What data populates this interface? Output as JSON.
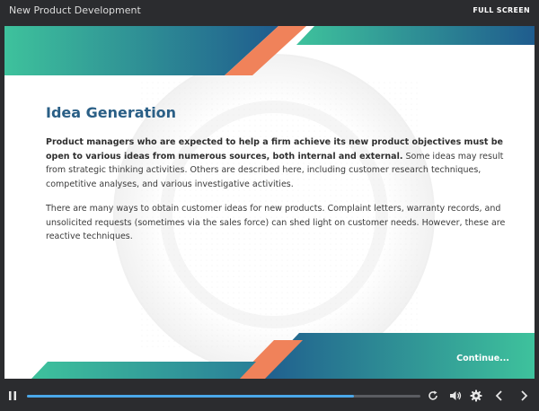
{
  "window": {
    "title": "New Product Development",
    "fullscreen_label": "FULL SCREEN"
  },
  "slide": {
    "heading": "Idea Generation",
    "paragraph1_bold": "Product managers who are expected to help a firm achieve its new product objectives must be open to various ideas from numerous sources, both internal and external.",
    "paragraph1_rest": " Some ideas may result from strategic thinking activities. Others are described here, including customer research techniques, competitive analyses, and various investigative activities.",
    "paragraph2": "There are many ways to obtain customer ideas for new products. Complaint letters, warranty records, and unsolicited requests (sometimes via the sales force) can shed light on customer needs. However, these are reactive techniques.",
    "continue_label": "Continue..."
  },
  "player": {
    "progress_percent": 83,
    "icons": [
      "pause-icon",
      "replay-icon",
      "volume-icon",
      "settings-icon",
      "previous-icon",
      "next-icon"
    ]
  },
  "colors": {
    "teal": "#3ec29c",
    "blue": "#1f5c8e",
    "orange": "#f0825a",
    "heading": "#2a5f86",
    "progress": "#4aa7e8"
  }
}
